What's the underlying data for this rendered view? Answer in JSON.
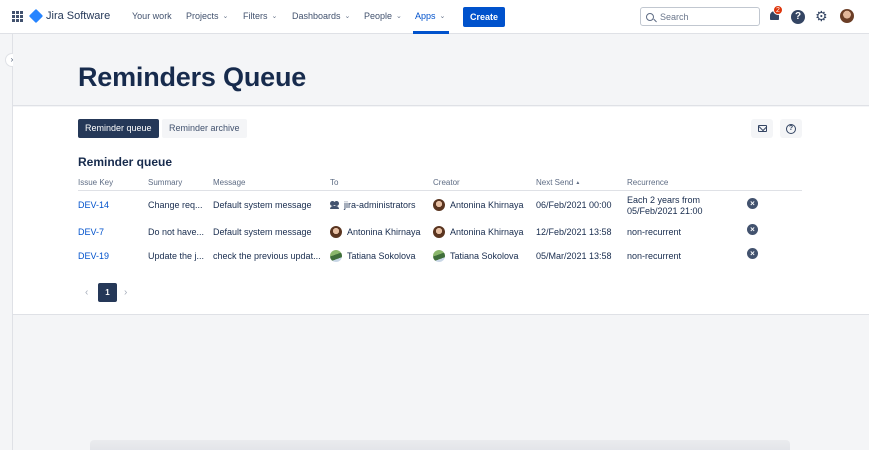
{
  "nav": {
    "logo_text": "Jira Software",
    "items": [
      {
        "label": "Your work"
      },
      {
        "label": "Projects"
      },
      {
        "label": "Filters"
      },
      {
        "label": "Dashboards"
      },
      {
        "label": "People"
      },
      {
        "label": "Apps"
      }
    ],
    "create_label": "Create",
    "search_placeholder": "Search",
    "notification_count": "2",
    "help_glyph": "?",
    "settings_glyph": "⚙",
    "colors": {
      "accent": "#0052cc",
      "badge": "#de350b"
    }
  },
  "sidebar": {
    "toggle_glyph": "›"
  },
  "page": {
    "title": "Reminders Queue",
    "tabs": {
      "active": "Reminder queue",
      "inactive": "Reminder archive"
    },
    "section_title": "Reminder queue"
  },
  "table": {
    "columns": {
      "issue_key": "Issue Key",
      "summary": "Summary",
      "message": "Message",
      "to": "To",
      "creator": "Creator",
      "next_send": "Next Send",
      "recurrence": "Recurrence"
    },
    "sort_glyph": "▲",
    "rows": [
      {
        "issue_key": "DEV-14",
        "summary": "Change req...",
        "message": "Default system message",
        "to": "jira-administrators",
        "to_icon": "group-icon",
        "creator": "Antonina Khirnaya",
        "next_send": "06/Feb/2021 00:00",
        "recurrence": "Each 2 years from 05/Feb/2021 21:00"
      },
      {
        "issue_key": "DEV-7",
        "summary": "Do not have...",
        "message": "Default system message",
        "to": "Antonina Khirnaya",
        "to_icon": "avatar",
        "creator": "Antonina Khirnaya",
        "next_send": "12/Feb/2021 13:58",
        "recurrence": "non-recurrent"
      },
      {
        "issue_key": "DEV-19",
        "summary": "Update the j...",
        "message": "check the previous updat...",
        "to": "Tatiana Sokolova",
        "to_icon": "avatar",
        "creator": "Tatiana Sokolova",
        "next_send": "05/Mar/2021 13:58",
        "recurrence": "non-recurrent"
      }
    ],
    "remove_glyph": "×"
  },
  "pagination": {
    "prev": "‹",
    "current": "1",
    "next": "›"
  }
}
